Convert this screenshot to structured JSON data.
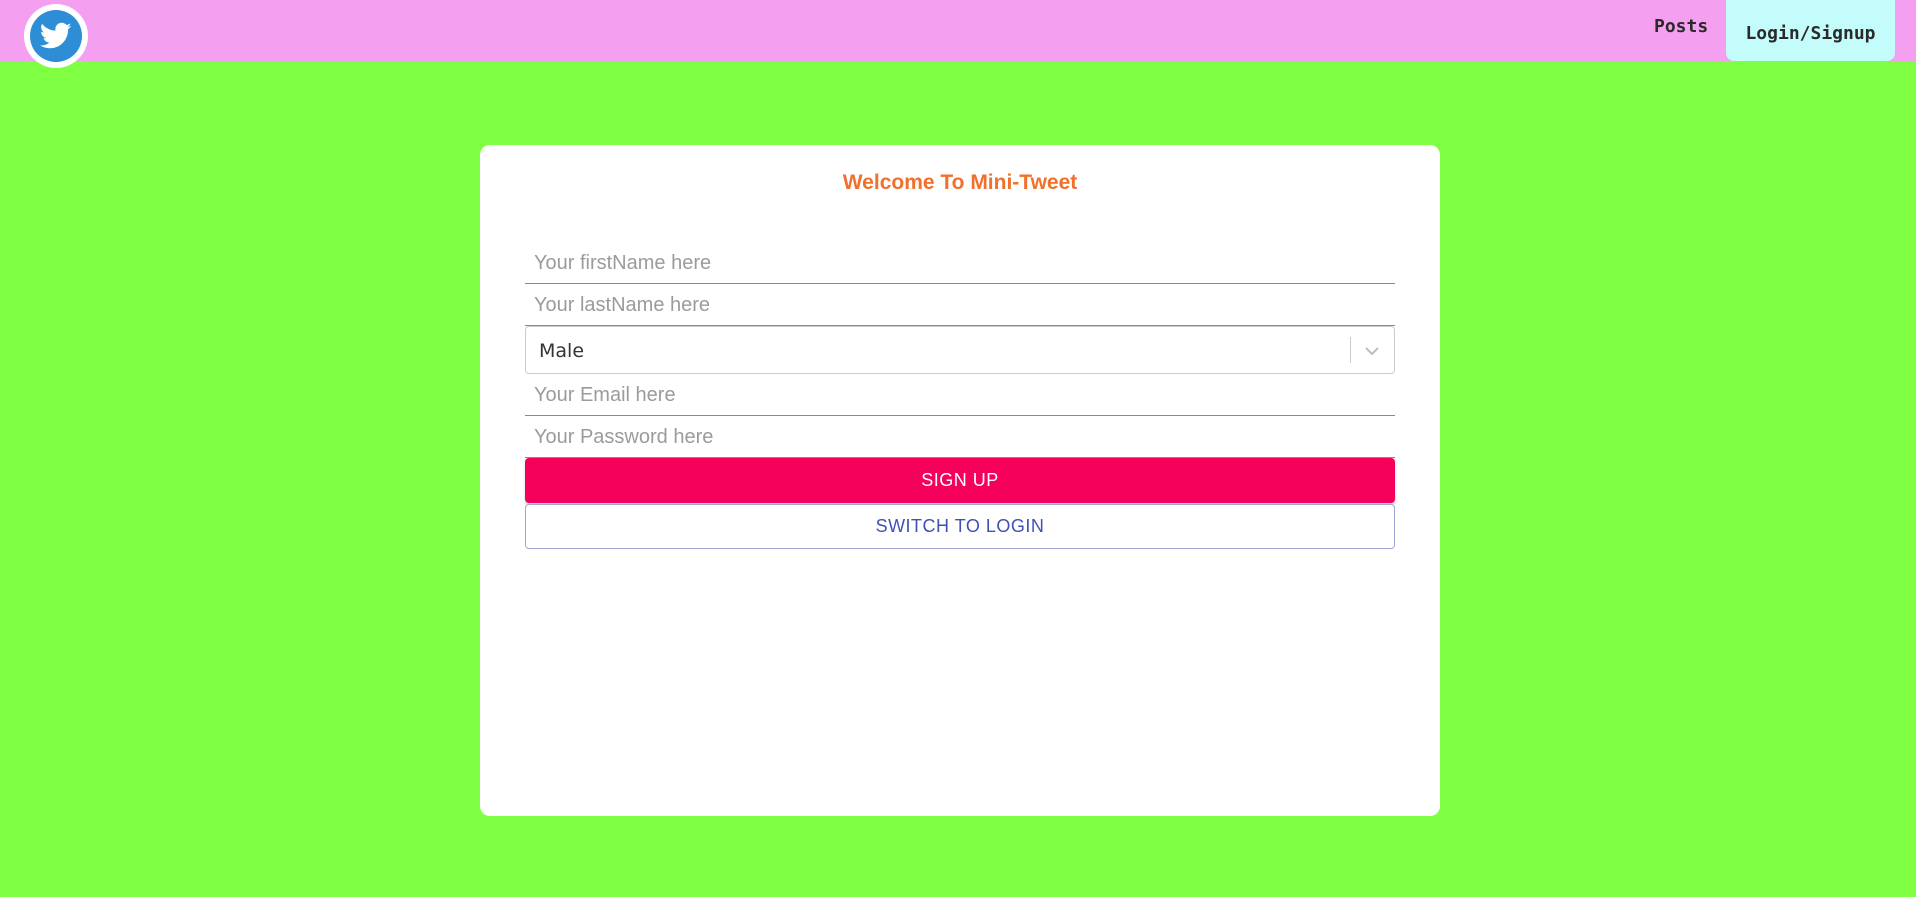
{
  "header": {
    "logo_icon": "twitter-bird-icon",
    "nav": {
      "posts_label": "Posts",
      "login_label": "Login/Signup"
    }
  },
  "form": {
    "title": "Welcome To Mini-Tweet",
    "first_name": {
      "value": "",
      "placeholder": "Your firstName here"
    },
    "last_name": {
      "value": "",
      "placeholder": "Your lastName here"
    },
    "gender": {
      "selected": "Male",
      "icon": "chevron-down-icon"
    },
    "email": {
      "value": "",
      "placeholder": "Your Email here"
    },
    "password": {
      "value": "",
      "placeholder": "Your Password here"
    },
    "signup_label": "SIGN UP",
    "switch_label": "SWITCH TO LOGIN"
  },
  "colors": {
    "background": "#7fff42",
    "header": "#f59ff0",
    "login_tab": "#c4fbfb",
    "title": "#f0702c",
    "signup_button": "#f5005a",
    "switch_text": "#3f51b5"
  }
}
